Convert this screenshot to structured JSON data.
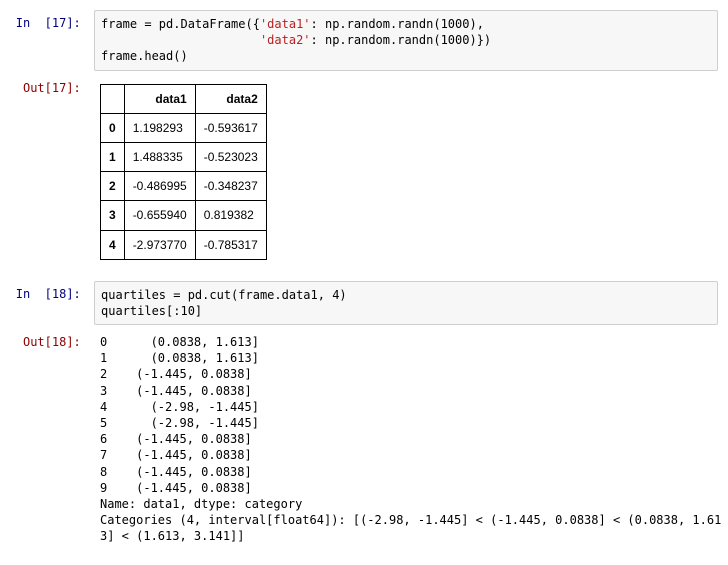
{
  "cells": {
    "c17": {
      "in_prompt": "In  [17]: ",
      "out_prompt": "Out[17]: ",
      "code_prefix1": "frame = pd.DataFrame({",
      "str_data1": "'data1'",
      "code_mid1": ": np.random.randn(1000),",
      "code_prefix2": "                      ",
      "str_data2": "'data2'",
      "code_mid2": ": np.random.randn(1000)})",
      "code_line3": "frame.head()",
      "table": {
        "columns": [
          "data1",
          "data2"
        ],
        "rows": [
          {
            "idx": "0",
            "data1": "1.198293",
            "data2": "-0.593617"
          },
          {
            "idx": "1",
            "data1": "1.488335",
            "data2": "-0.523023"
          },
          {
            "idx": "2",
            "data1": "-0.486995",
            "data2": "-0.348237"
          },
          {
            "idx": "3",
            "data1": "-0.655940",
            "data2": "0.819382"
          },
          {
            "idx": "4",
            "data1": "-2.973770",
            "data2": "-0.785317"
          }
        ]
      }
    },
    "c18": {
      "in_prompt": "In  [18]: ",
      "out_prompt": "Out[18]: ",
      "code_line1": "quartiles = pd.cut(frame.data1, 4)",
      "code_line2": "quartiles[:10]",
      "output_lines": [
        "0      (0.0838, 1.613]",
        "1      (0.0838, 1.613]",
        "2    (-1.445, 0.0838]",
        "3    (-1.445, 0.0838]",
        "4      (-2.98, -1.445]",
        "5      (-2.98, -1.445]",
        "6    (-1.445, 0.0838]",
        "7    (-1.445, 0.0838]",
        "8    (-1.445, 0.0838]",
        "9    (-1.445, 0.0838]",
        "Name: data1, dtype: category",
        "Categories (4, interval[float64]): [(-2.98, -1.445] < (-1.445, 0.0838] < (0.0838, 1.61",
        "3] < (1.613, 3.141]]"
      ]
    }
  }
}
